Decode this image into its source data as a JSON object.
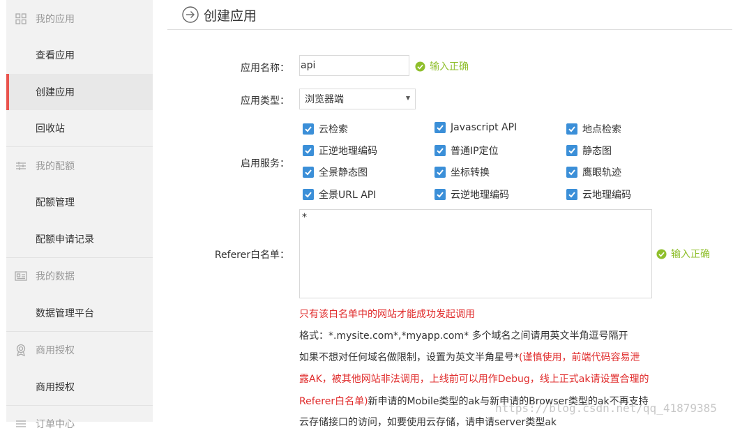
{
  "sidebar": {
    "groups": [
      {
        "title": "我的应用",
        "icon": "grid-icon"
      },
      {
        "title": "我的配额",
        "icon": "sliders-icon"
      },
      {
        "title": "我的数据",
        "icon": "id-card-icon"
      },
      {
        "title": "商用授权",
        "icon": "award-icon"
      },
      {
        "title": "订单中心",
        "icon": "list-icon"
      }
    ],
    "items": [
      {
        "label": "查看应用"
      },
      {
        "label": "创建应用",
        "active": true
      },
      {
        "label": "回收站"
      },
      {
        "label": "配额管理"
      },
      {
        "label": "配额申请记录"
      },
      {
        "label": "数据管理平台"
      },
      {
        "label": "商用授权"
      }
    ],
    "accent_color": "#e9534d"
  },
  "header": {
    "title": "创建应用",
    "icon": "arrow-right-circle-icon"
  },
  "form": {
    "app_name": {
      "label": "应用名称：",
      "value": "api",
      "validation": "输入正确"
    },
    "app_type": {
      "label": "应用类型：",
      "value": "浏览器端"
    },
    "services": {
      "label": "启用服务：",
      "items": [
        {
          "label": "云检索",
          "checked": true
        },
        {
          "label": "Javascript API",
          "checked": true
        },
        {
          "label": "地点检索",
          "checked": true
        },
        {
          "label": "正逆地理编码",
          "checked": true
        },
        {
          "label": "普通IP定位",
          "checked": true
        },
        {
          "label": "静态图",
          "checked": true
        },
        {
          "label": "全景静态图",
          "checked": true
        },
        {
          "label": "坐标转换",
          "checked": true
        },
        {
          "label": "鹰眼轨迹",
          "checked": true
        },
        {
          "label": "全景URL API",
          "checked": true
        },
        {
          "label": "云逆地理编码",
          "checked": true
        },
        {
          "label": "云地理编码",
          "checked": true
        }
      ]
    },
    "referer": {
      "label": "Referer白名单：",
      "value": "*",
      "validation": "输入正确"
    },
    "notes": {
      "line1": "只有该白名单中的网站才能成功发起调用",
      "line2": "格式：*.mysite.com*,*myapp.com* 多个域名之间请用英文半角逗号隔开",
      "line3_a": "如果不想对任何域名做限制，设置为英文半角星号*",
      "line3_b": "(谨慎使用，前端代码容易泄",
      "line4": "露AK，被其他网站非法调用，上线前可以用作Debug，线上正式ak请设置合理的",
      "line5_a": "Referer白名单)",
      "line5_b": "新申请的Mobile类型的ak与新申请的Browser类型的ak不再支持",
      "line6": "云存储接口的访问，如要使用云存储，请申请server类型ak"
    }
  },
  "colors": {
    "valid": "#8fbf2c",
    "checkbox": "#3b8fd8",
    "warning": "#e02c2c"
  },
  "watermark": "https://blog.csdn.net/qq_41879385"
}
